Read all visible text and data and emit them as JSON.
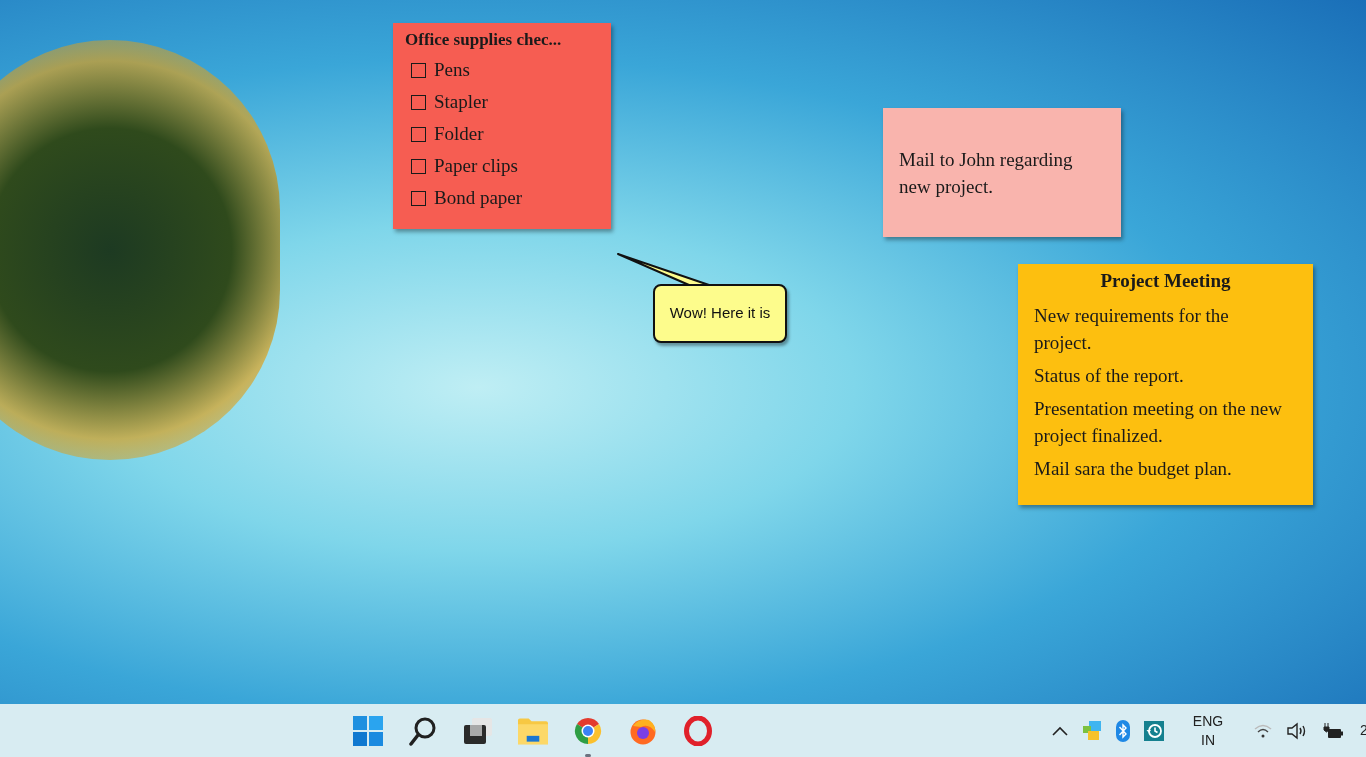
{
  "desktop": {
    "notes": [
      {
        "kind": "checklist",
        "title": "Office supplies chec...",
        "color": "#f65d52",
        "items": [
          {
            "label": "Pens",
            "checked": false
          },
          {
            "label": "Stapler",
            "checked": false
          },
          {
            "label": "Folder",
            "checked": false
          },
          {
            "label": "Paper clips",
            "checked": false
          },
          {
            "label": "Bond paper",
            "checked": false
          }
        ]
      },
      {
        "kind": "text",
        "color": "#f9b4ad",
        "lines": [
          "Mail to John regarding new project."
        ]
      },
      {
        "kind": "list",
        "title": "Project Meeting",
        "color": "#fdbf0f",
        "lines": [
          "New requirements for the project.",
          "Status of the report.",
          "Presentation meeting on the new project finalized.",
          "Mail sara the budget plan."
        ]
      }
    ],
    "callout": {
      "text": "Wow! Here it is"
    }
  },
  "taskbar": {
    "apps": [
      {
        "kind": "start",
        "running": false
      },
      {
        "kind": "search",
        "running": false
      },
      {
        "kind": "taskview",
        "running": false
      },
      {
        "kind": "folder",
        "running": false
      },
      {
        "kind": "chrome",
        "running": true
      },
      {
        "kind": "firefox",
        "running": false
      },
      {
        "kind": "opera",
        "running": false
      }
    ],
    "tray": {
      "language": [
        "ENG",
        "IN"
      ],
      "clock": "2"
    }
  }
}
